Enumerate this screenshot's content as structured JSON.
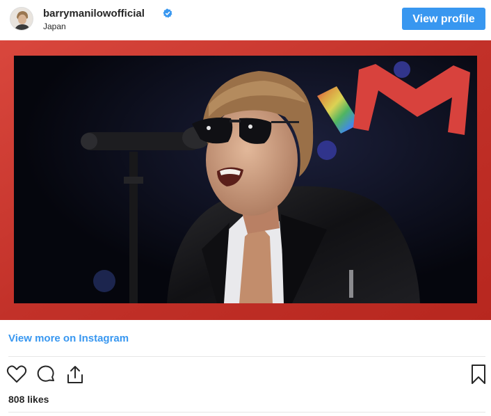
{
  "post": {
    "username": "barrymanilowofficial",
    "location": "Japan",
    "view_profile_label": "View profile",
    "view_more_label": "View more on Instagram",
    "likes": "808 likes"
  },
  "icons": [
    "verified-badge-icon",
    "heart-icon",
    "comment-icon",
    "share-icon",
    "bookmark-icon"
  ],
  "colors": {
    "accent": "#3897f0",
    "frame_red": "#c8372f",
    "text": "#262626"
  }
}
